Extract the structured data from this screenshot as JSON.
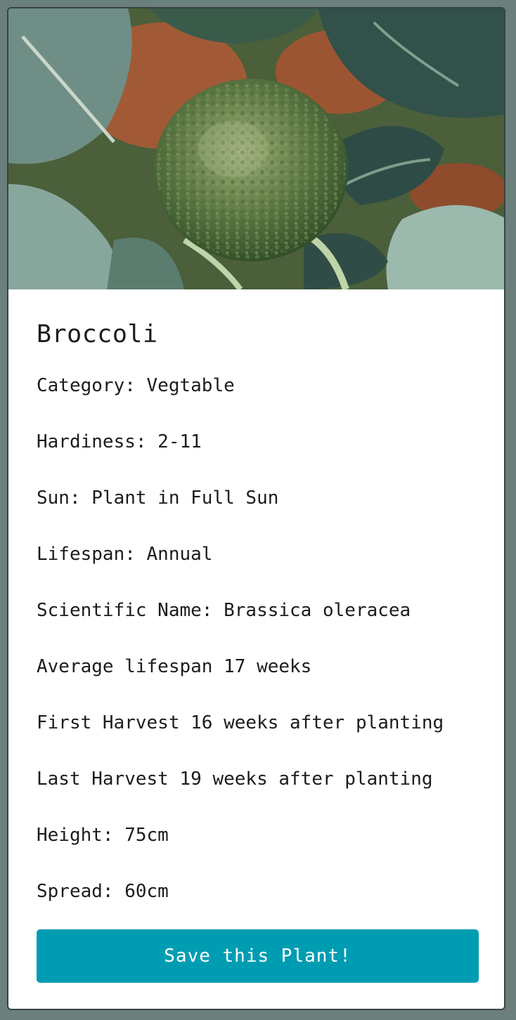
{
  "plant": {
    "photo_label": "broccoli-photo",
    "name": "Broccoli",
    "facts": [
      "Category: Vegtable",
      "Hardiness: 2-11",
      "Sun: Plant in Full Sun",
      "Lifespan: Annual",
      "Scientific Name: Brassica oleracea",
      "Average lifespan 17 weeks",
      "First Harvest 16 weeks after planting",
      "Last Harvest 19 weeks after planting",
      "Height: 75cm",
      "Spread: 60cm"
    ]
  },
  "actions": {
    "save_label": "Save this Plant!"
  },
  "colors": {
    "page_background": "#6b7f7d",
    "card_background": "#ffffff",
    "button_background": "#009db2",
    "button_text": "#ffffff"
  }
}
